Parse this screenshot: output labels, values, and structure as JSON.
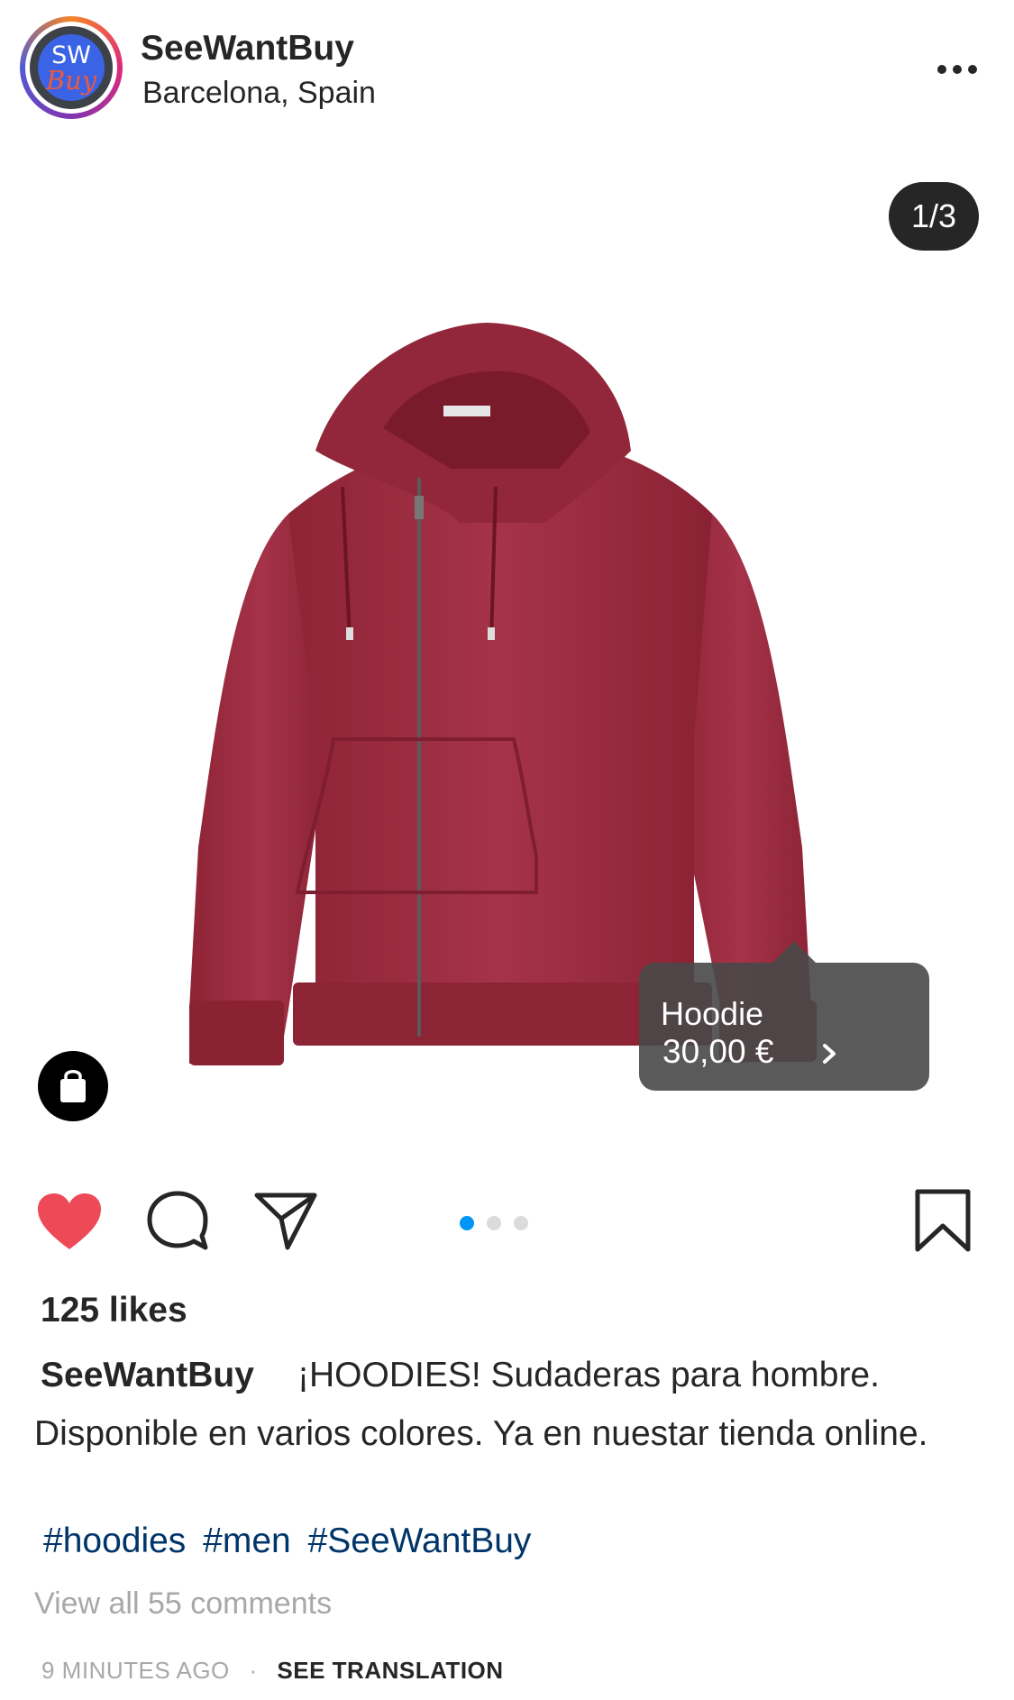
{
  "post": {
    "username": "SeeWantBuy",
    "location": "Barcelona, Spain",
    "avatar": {
      "line1": "SW",
      "line2": "Buy"
    },
    "menu_icon": "more-horizontal-icon"
  },
  "media": {
    "counter": "1/3",
    "current_slide": 1,
    "total_slides": 3,
    "product_tag": {
      "name": "Hoodie",
      "price": "30,00 €"
    },
    "shop_icon": "shopping-bag-icon"
  },
  "actions": {
    "like_icon": "heart-filled-icon",
    "comment_icon": "comment-icon",
    "share_icon": "send-icon",
    "save_icon": "bookmark-icon",
    "liked": true
  },
  "likes": "125 likes",
  "caption": {
    "username": "SeeWantBuy",
    "line1": "¡HOODIES! Sudaderas para hombre.",
    "line2": "Disponible en varios colores. Ya en nuestar tienda online."
  },
  "hashtags": [
    "#hoodies",
    "#men",
    "#SeeWantBuy"
  ],
  "comments_link": "View all 55 comments",
  "footer": {
    "time": "9 MINUTES AGO",
    "separator": "·",
    "translation": "SEE TRANSLATION"
  },
  "colors": {
    "like": "#ed4956",
    "active_dot": "#0095f6",
    "inactive_dot": "#dbdbdb",
    "hashtag": "#003569",
    "hoodie": "#9b2a3c",
    "tag_background": "#484848"
  }
}
